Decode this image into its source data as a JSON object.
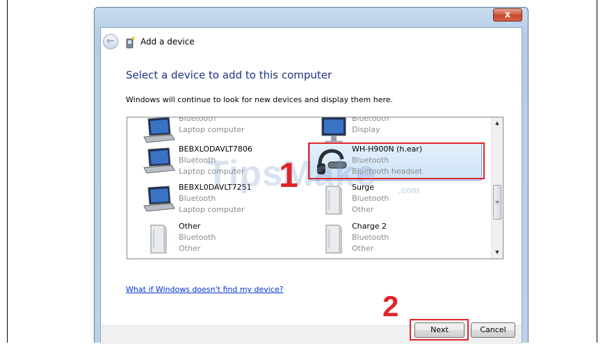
{
  "window": {
    "title": "Add a device",
    "close_label": "x"
  },
  "main": {
    "heading": "Select a device to add to this computer",
    "subtext": "Windows will continue to look for new devices and display them here.",
    "help_link": "What if Windows doesn't find my device?"
  },
  "devices": [
    {
      "name": "",
      "type": "Bluetooth",
      "category": "Laptop computer",
      "icon": "laptop-icon"
    },
    {
      "name": "",
      "type": "Bluetooth",
      "category": "Display",
      "icon": "display-icon"
    },
    {
      "name": "BEBXLODAVLT7806",
      "type": "Bluetooth",
      "category": "Laptop computer",
      "icon": "laptop-icon"
    },
    {
      "name": "WH-H900N (h.ear)",
      "type": "Bluetooth",
      "category": "Bluetooth headset",
      "icon": "headset-icon",
      "selected": true
    },
    {
      "name": "BEBXL0DAVLT7251",
      "type": "Bluetooth",
      "category": "Laptop computer",
      "icon": "laptop-icon"
    },
    {
      "name": "Surge",
      "type": "Bluetooth",
      "category": "Other",
      "icon": "generic-device-icon"
    },
    {
      "name": "Other",
      "type": "Bluetooth",
      "category": "Other",
      "icon": "generic-device-icon"
    },
    {
      "name": "Charge 2",
      "type": "Bluetooth",
      "category": "Other",
      "icon": "generic-device-icon"
    }
  ],
  "buttons": {
    "next": "Next",
    "cancel": "Cancel"
  },
  "annotations": {
    "step1": "1",
    "step2": "2",
    "color": "#e0242b"
  },
  "watermark": {
    "text": "TipsMake",
    "suffix": ".com"
  }
}
